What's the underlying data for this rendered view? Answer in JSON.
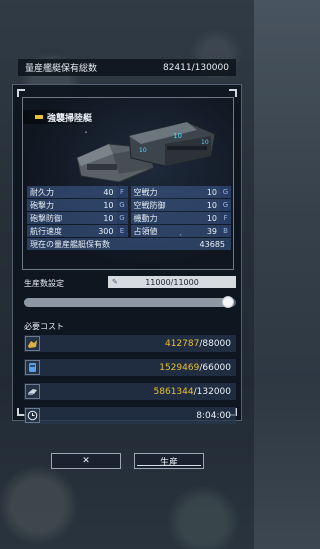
{
  "header": {
    "label": "量産艦艇保有総数",
    "value": "82411/130000"
  },
  "ship": {
    "name": "強襲掃陸艇",
    "stats": [
      {
        "label": "耐久力",
        "value": "40",
        "rank": "F"
      },
      {
        "label": "空戦力",
        "value": "10",
        "rank": "G"
      },
      {
        "label": "砲撃力",
        "value": "10",
        "rank": "G"
      },
      {
        "label": "空戦防御",
        "value": "10",
        "rank": "G"
      },
      {
        "label": "砲撃防御",
        "value": "10",
        "rank": "G"
      },
      {
        "label": "機動力",
        "value": "10",
        "rank": "F"
      },
      {
        "label": "航行速度",
        "value": "300",
        "rank": "E"
      },
      {
        "label": "占領値",
        "value": "39",
        "rank": "B"
      }
    ],
    "total_label": "現在の量産艦艇保有数",
    "total_value": "43685"
  },
  "production": {
    "setting_label": "生産数設定",
    "quantity": "11000/11000",
    "slider_fraction": 1.0
  },
  "cost": {
    "label": "必要コスト",
    "rows": [
      {
        "icon": "ore-icon",
        "have": "412787",
        "need": "/88000"
      },
      {
        "icon": "fuel-icon",
        "have": "1529469",
        "need": "/66000"
      },
      {
        "icon": "ammo-icon",
        "have": "5861344",
        "need": "/132000"
      }
    ],
    "time": "8:04:00"
  },
  "buttons": {
    "cancel": "✕",
    "produce": "生産"
  },
  "colors": {
    "accent_yellow": "#e8c030",
    "stat_blue": "#4260a0"
  }
}
